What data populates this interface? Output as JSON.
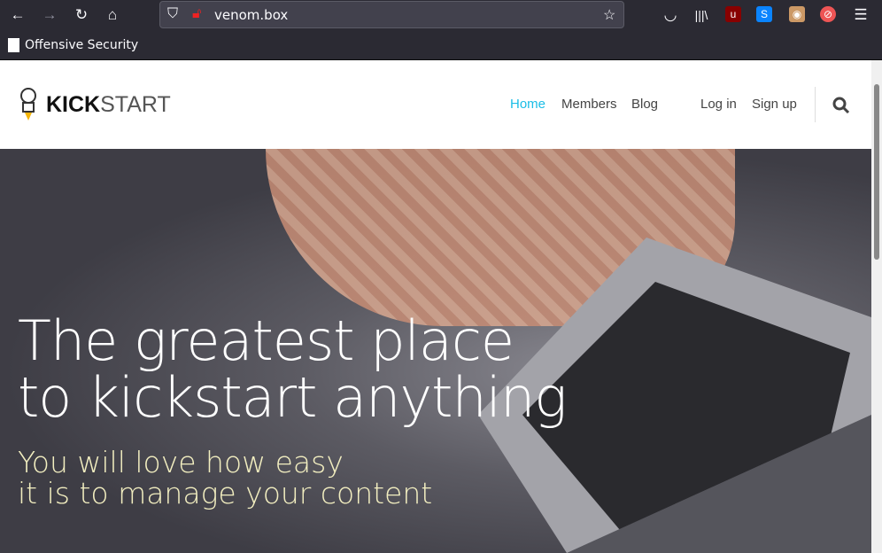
{
  "browser": {
    "url": "venom.box",
    "bookmark": "Offensive Security",
    "icons": [
      "back-icon",
      "forward-icon",
      "reload-icon",
      "home-icon",
      "shield-icon",
      "lock-insecure-icon",
      "star-icon",
      "pocket-icon",
      "library-icon",
      "ublock-icon",
      "s-extension-icon",
      "avatar-extension-icon",
      "blocked-extension-icon",
      "menu-icon"
    ]
  },
  "site": {
    "logo_bold": "KICK",
    "logo_light": "START",
    "nav": [
      {
        "label": "Home",
        "active": true
      },
      {
        "label": "Members"
      },
      {
        "label": "Blog"
      },
      {
        "label": "Log in"
      },
      {
        "label": "Sign up"
      }
    ],
    "accent": "#1bbde6",
    "hero": {
      "title_line1": "The greatest place",
      "title_line2": "to kickstart anything",
      "subtitle_line1": "You will love how easy",
      "subtitle_line2": "it is to manage your content"
    }
  }
}
